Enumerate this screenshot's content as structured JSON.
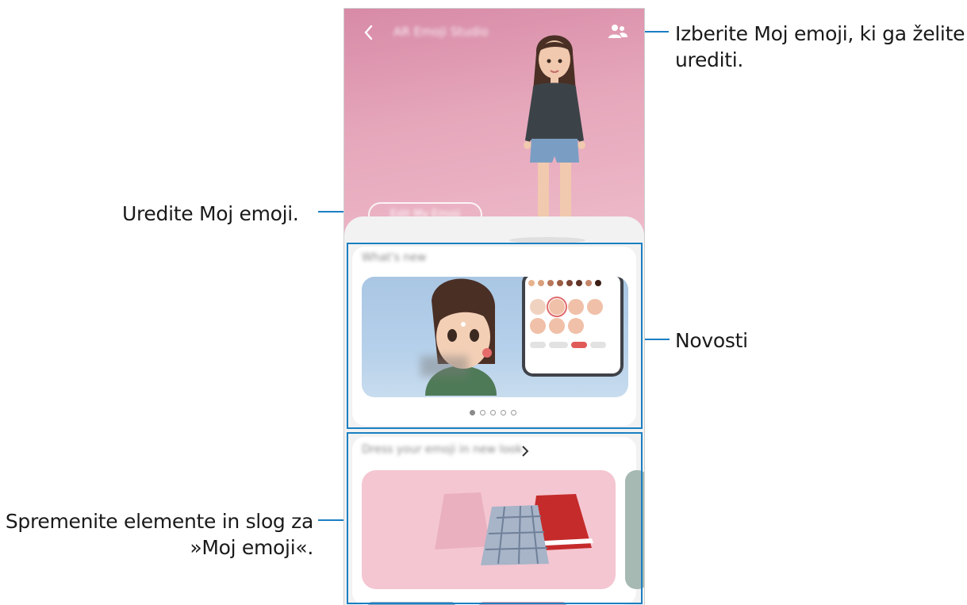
{
  "callouts": {
    "select_emoji": "Izberite Moj emoji, ki ga želite\nurediti.",
    "edit_emoji": "Uredite Moj emoji.",
    "news": "Novosti",
    "change_items": "Spremenite elemente in slog za\n»Moj emoji«."
  },
  "app": {
    "title": "AR Emoji Studio",
    "edit_button": "Edit My Emoji",
    "whats_new": "What's new",
    "dress_up": "Dress your emoji in new look"
  },
  "banner_indicator": {
    "count": 5,
    "active_index": 0
  },
  "colors": {
    "accent": "#1a7fc2",
    "hero_top": "#d78aa6",
    "hero_bottom": "#eebccb",
    "banner": "#b5d0ea",
    "skirt_card": "#f4c6d1"
  },
  "icons": [
    "back-arrow-icon",
    "people-icon",
    "chevron-right-icon"
  ]
}
